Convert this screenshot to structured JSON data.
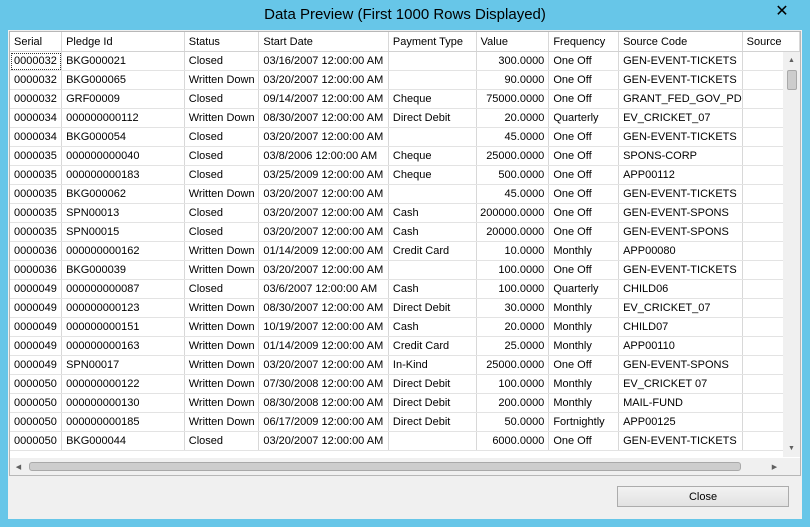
{
  "window": {
    "title": "Data Preview (First 1000 Rows Displayed)",
    "close_glyph": "✕"
  },
  "grid": {
    "columns": [
      "Serial",
      "Pledge Id",
      "Status",
      "Start Date",
      "Payment Type",
      "Value",
      "Frequency",
      "Source Code",
      "Source"
    ],
    "rows": [
      [
        "0000032",
        "BKG000021",
        "Closed",
        "03/16/2007 12:00:00 AM",
        "",
        "300.0000",
        "One Off",
        "GEN-EVENT-TICKETS",
        ""
      ],
      [
        "0000032",
        "BKG000065",
        "Written Down",
        "03/20/2007 12:00:00 AM",
        "",
        "90.0000",
        "One Off",
        "GEN-EVENT-TICKETS",
        ""
      ],
      [
        "0000032",
        "GRF00009",
        "Closed",
        "09/14/2007 12:00:00 AM",
        "Cheque",
        "75000.0000",
        "One Off",
        "GRANT_FED_GOV_PD",
        ""
      ],
      [
        "0000034",
        "000000000112",
        "Written Down",
        "08/30/2007 12:00:00 AM",
        "Direct Debit",
        "20.0000",
        "Quarterly",
        "EV_CRICKET_07",
        ""
      ],
      [
        "0000034",
        "BKG000054",
        "Closed",
        "03/20/2007 12:00:00 AM",
        "",
        "45.0000",
        "One Off",
        "GEN-EVENT-TICKETS",
        ""
      ],
      [
        "0000035",
        "000000000040",
        "Closed",
        "03/8/2006 12:00:00 AM",
        "Cheque",
        "25000.0000",
        "One Off",
        "SPONS-CORP",
        ""
      ],
      [
        "0000035",
        "000000000183",
        "Closed",
        "03/25/2009 12:00:00 AM",
        "Cheque",
        "500.0000",
        "One Off",
        "APP00112",
        ""
      ],
      [
        "0000035",
        "BKG000062",
        "Written Down",
        "03/20/2007 12:00:00 AM",
        "",
        "45.0000",
        "One Off",
        "GEN-EVENT-TICKETS",
        ""
      ],
      [
        "0000035",
        "SPN00013",
        "Closed",
        "03/20/2007 12:00:00 AM",
        "Cash",
        "200000.0000",
        "One Off",
        "GEN-EVENT-SPONS",
        ""
      ],
      [
        "0000035",
        "SPN00015",
        "Closed",
        "03/20/2007 12:00:00 AM",
        "Cash",
        "20000.0000",
        "One Off",
        "GEN-EVENT-SPONS",
        ""
      ],
      [
        "0000036",
        "000000000162",
        "Written Down",
        "01/14/2009 12:00:00 AM",
        "Credit Card",
        "10.0000",
        "Monthly",
        "APP00080",
        ""
      ],
      [
        "0000036",
        "BKG000039",
        "Written Down",
        "03/20/2007 12:00:00 AM",
        "",
        "100.0000",
        "One Off",
        "GEN-EVENT-TICKETS",
        ""
      ],
      [
        "0000049",
        "000000000087",
        "Closed",
        "03/6/2007 12:00:00 AM",
        "Cash",
        "100.0000",
        "Quarterly",
        "CHILD06",
        ""
      ],
      [
        "0000049",
        "000000000123",
        "Written Down",
        "08/30/2007 12:00:00 AM",
        "Direct Debit",
        "30.0000",
        "Monthly",
        "EV_CRICKET_07",
        ""
      ],
      [
        "0000049",
        "000000000151",
        "Written Down",
        "10/19/2007 12:00:00 AM",
        "Cash",
        "20.0000",
        "Monthly",
        "CHILD07",
        ""
      ],
      [
        "0000049",
        "000000000163",
        "Written Down",
        "01/14/2009 12:00:00 AM",
        "Credit Card",
        "25.0000",
        "Monthly",
        "APP00110",
        ""
      ],
      [
        "0000049",
        "SPN00017",
        "Written Down",
        "03/20/2007 12:00:00 AM",
        "In-Kind",
        "25000.0000",
        "One Off",
        "GEN-EVENT-SPONS",
        ""
      ],
      [
        "0000050",
        "000000000122",
        "Written Down",
        "07/30/2008 12:00:00 AM",
        "Direct Debit",
        "100.0000",
        "Monthly",
        "EV_CRICKET 07",
        ""
      ],
      [
        "0000050",
        "000000000130",
        "Written Down",
        "08/30/2008 12:00:00 AM",
        "Direct Debit",
        "200.0000",
        "Monthly",
        "MAIL-FUND",
        ""
      ],
      [
        "0000050",
        "000000000185",
        "Written Down",
        "06/17/2009 12:00:00 AM",
        "Direct Debit",
        "50.0000",
        "Fortnightly",
        "APP00125",
        ""
      ],
      [
        "0000050",
        "BKG000044",
        "Closed",
        "03/20/2007 12:00:00 AM",
        "",
        "6000.0000",
        "One Off",
        "GEN-EVENT-TICKETS",
        ""
      ]
    ]
  },
  "footer": {
    "close_label": "Close"
  }
}
